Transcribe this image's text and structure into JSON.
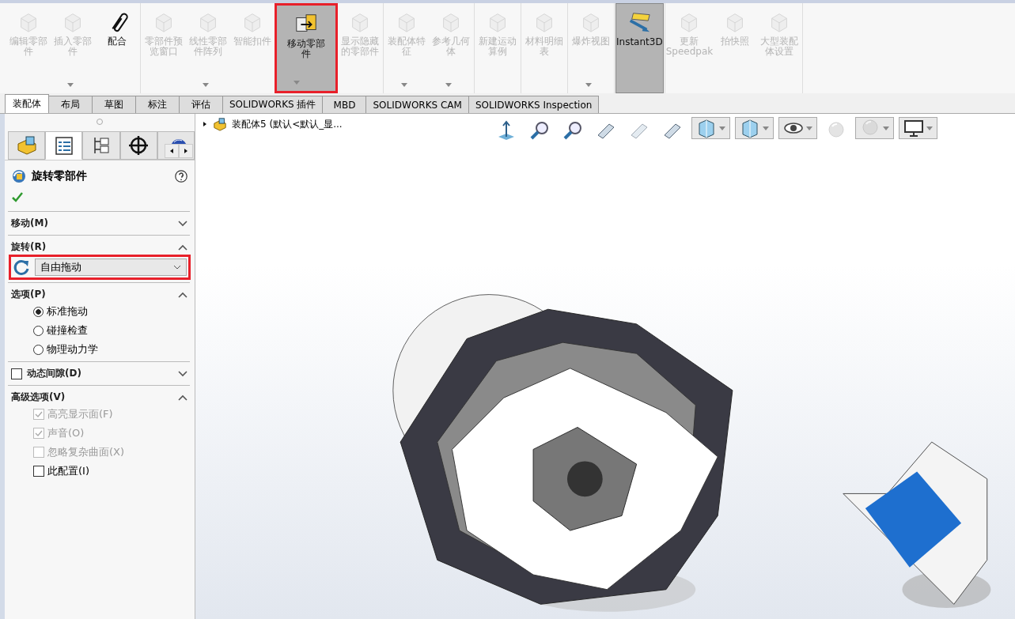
{
  "toolbar": {
    "groups": [
      {
        "buttons": [
          {
            "label": "编辑零部件",
            "disabled": true,
            "dropdown": false,
            "selected": false,
            "highlighted": false
          },
          {
            "label": "插入零部件",
            "disabled": true,
            "dropdown": true,
            "selected": false,
            "highlighted": false
          },
          {
            "label": "配合",
            "disabled": false,
            "dropdown": false,
            "selected": false,
            "highlighted": false
          }
        ]
      },
      {
        "buttons": [
          {
            "label": "零部件预览窗口",
            "disabled": true,
            "dropdown": false,
            "selected": false,
            "highlighted": false
          },
          {
            "label": "线性零部件阵列",
            "disabled": true,
            "dropdown": true,
            "selected": false,
            "highlighted": false
          },
          {
            "label": "智能扣件",
            "disabled": true,
            "dropdown": false,
            "selected": false,
            "highlighted": false
          },
          {
            "label": "移动零部件",
            "disabled": false,
            "dropdown": true,
            "selected": true,
            "highlighted": true
          },
          {
            "label": "显示隐藏的零部件",
            "disabled": true,
            "dropdown": false,
            "selected": false,
            "highlighted": false
          }
        ]
      },
      {
        "buttons": [
          {
            "label": "装配体特征",
            "disabled": true,
            "dropdown": true,
            "selected": false,
            "highlighted": false
          },
          {
            "label": "参考几何体",
            "disabled": true,
            "dropdown": true,
            "selected": false,
            "highlighted": false
          }
        ]
      },
      {
        "buttons": [
          {
            "label": "新建运动算例",
            "disabled": true,
            "dropdown": false,
            "selected": false,
            "highlighted": false
          }
        ]
      },
      {
        "buttons": [
          {
            "label": "材料明细表",
            "disabled": true,
            "dropdown": false,
            "selected": false,
            "highlighted": false
          }
        ]
      },
      {
        "buttons": [
          {
            "label": "爆炸视图",
            "disabled": true,
            "dropdown": true,
            "selected": false,
            "highlighted": false
          }
        ]
      },
      {
        "buttons": [
          {
            "label": "Instant3D",
            "disabled": false,
            "dropdown": false,
            "selected": true,
            "highlighted": false
          }
        ]
      },
      {
        "buttons": [
          {
            "label": "更新 Speedpak",
            "disabled": true,
            "dropdown": false,
            "selected": false,
            "highlighted": false
          },
          {
            "label": "拍快照",
            "disabled": true,
            "dropdown": false,
            "selected": false,
            "highlighted": false
          },
          {
            "label": "大型装配体设置",
            "disabled": true,
            "dropdown": false,
            "selected": false,
            "highlighted": false
          }
        ]
      }
    ]
  },
  "tabs": [
    {
      "label": "装配体",
      "selected": true
    },
    {
      "label": "布局",
      "selected": false
    },
    {
      "label": "草图",
      "selected": false
    },
    {
      "label": "标注",
      "selected": false
    },
    {
      "label": "评估",
      "selected": false
    },
    {
      "label": "SOLIDWORKS 插件",
      "selected": false
    },
    {
      "label": "MBD",
      "selected": false
    },
    {
      "label": "SOLIDWORKS CAM",
      "selected": false
    },
    {
      "label": "SOLIDWORKS Inspection",
      "selected": false
    }
  ],
  "panel": {
    "tabs": [
      {
        "selected": false
      },
      {
        "selected": true
      },
      {
        "selected": false
      },
      {
        "selected": false
      },
      {
        "selected": false
      }
    ],
    "title": "旋转零部件",
    "sections": [
      {
        "kind": "plain",
        "title": "移动(M)",
        "expanded": false
      },
      {
        "kind": "dropdown",
        "title": "旋转(R)",
        "expanded": true,
        "value": "自由拖动",
        "highlighted": true
      },
      {
        "kind": "radios",
        "title": "选项(P)",
        "expanded": true,
        "options": [
          {
            "label": "标准拖动",
            "selected": true
          },
          {
            "label": "碰撞检查",
            "selected": false
          },
          {
            "label": "物理动力学",
            "selected": false
          }
        ]
      },
      {
        "kind": "checkbox",
        "title": "动态间隙(D)",
        "expanded": false,
        "checked": false
      },
      {
        "kind": "checkboxes",
        "title": "高级选项(V)",
        "expanded": true,
        "options": [
          {
            "label": "高亮显示面(F)",
            "checked": true,
            "disabled": true
          },
          {
            "label": "声音(O)",
            "checked": true,
            "disabled": true
          },
          {
            "label": "忽略复杂曲面(X)",
            "checked": false,
            "disabled": true
          },
          {
            "label": "此配置(I)",
            "checked": false,
            "disabled": false
          }
        ]
      }
    ]
  },
  "viewport": {
    "tree_item": "装配体5 (默认<默认_显...",
    "view_tools": [
      {
        "dropdown": false,
        "disabled": false
      },
      {
        "dropdown": false,
        "disabled": false
      },
      {
        "dropdown": false,
        "disabled": false
      },
      {
        "dropdown": false,
        "disabled": false
      },
      {
        "dropdown": false,
        "disabled": true
      },
      {
        "dropdown": false,
        "disabled": false
      },
      {
        "dropdown": true,
        "disabled": false
      },
      {
        "dropdown": true,
        "disabled": false
      },
      {
        "dropdown": true,
        "disabled": false
      },
      {
        "dropdown": false,
        "disabled": true
      },
      {
        "dropdown": true,
        "disabled": true
      },
      {
        "dropdown": true,
        "disabled": false
      }
    ]
  }
}
